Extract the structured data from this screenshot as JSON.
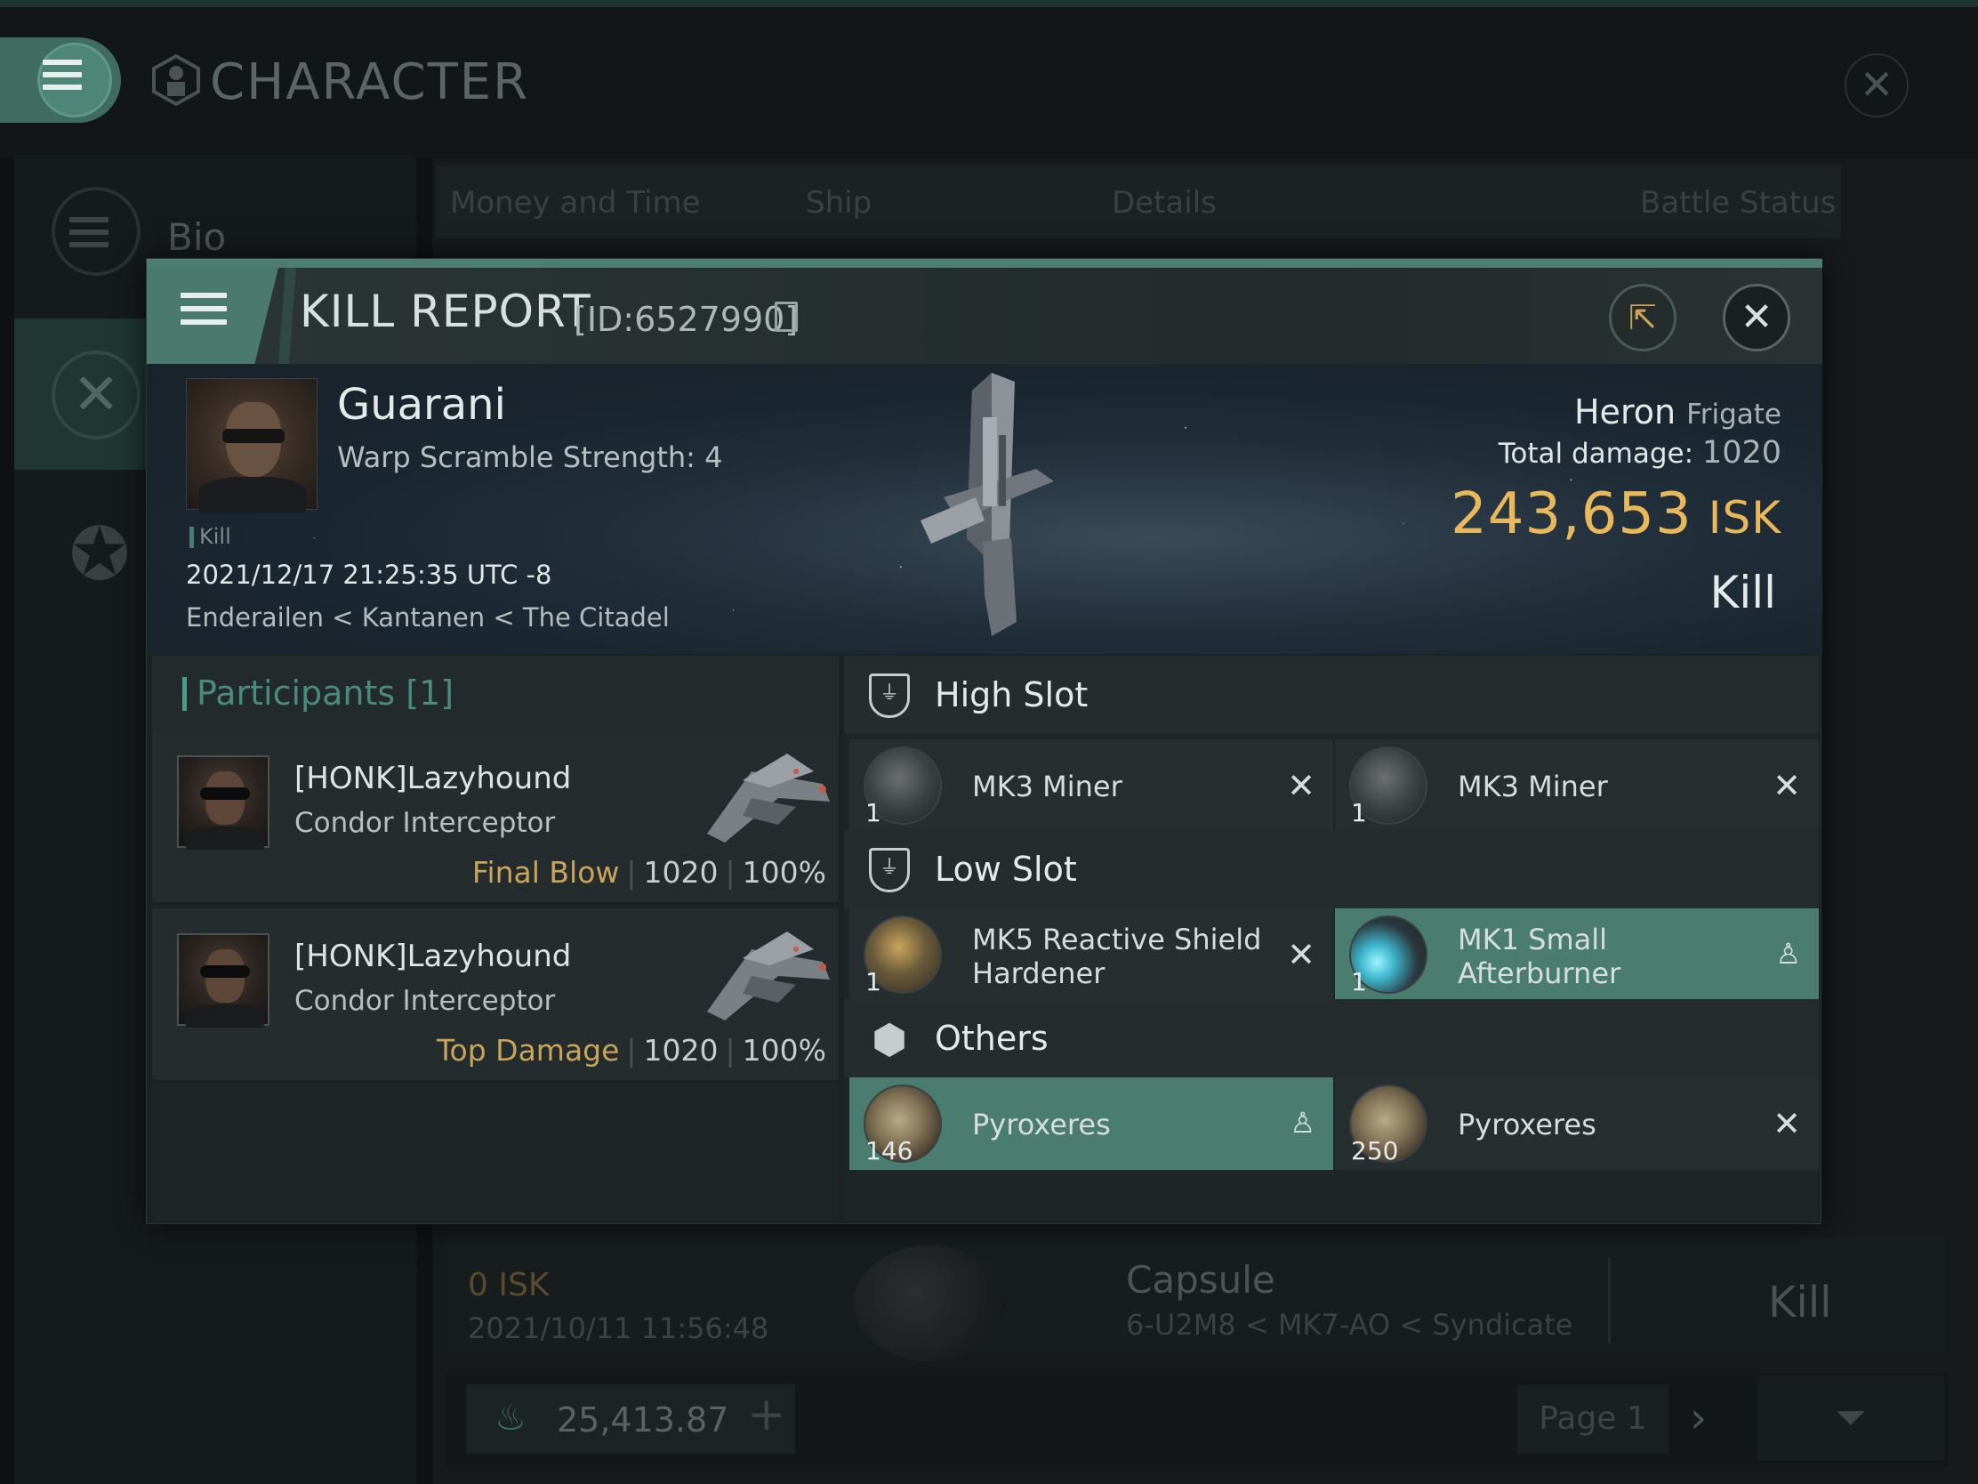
{
  "window": {
    "title": "CHARACTER",
    "close_glyph": "✕"
  },
  "sidebar": {
    "items": [
      {
        "label": "Bio",
        "icon": "hamburger-icon"
      },
      {
        "label": "",
        "icon": "crossed-swords-icon"
      },
      {
        "label": "",
        "icon": "star-icon"
      }
    ]
  },
  "tabs": [
    "Money and Time",
    "Ship",
    "Details",
    "Battle Status"
  ],
  "bg_row": {
    "isk": "0  ISK",
    "date": "2021/10/11  11:56:48",
    "ship": "Capsule",
    "location": "6-U2M8 < MK7-AO < Syndicate",
    "result": "Kill"
  },
  "bottom_bar": {
    "wallet": "25,413.87",
    "page": "Page 1"
  },
  "kill_report": {
    "title": "KILL REPORT",
    "id": "[ID:6527990]",
    "victim": {
      "name": "Guarani",
      "warp": "Warp Scramble Strength: 4",
      "tag": "Kill",
      "time": "2021/12/17 21:25:35 UTC -8",
      "location": "Enderailen < Kantanen < The Citadel",
      "ship": "Heron",
      "ship_class": "Frigate",
      "total_damage_label": "Total damage:",
      "total_damage": "1020",
      "isk_value": "243,653",
      "isk_unit": "ISK",
      "result": "Kill"
    },
    "participants": {
      "label": "Participants [1]",
      "rows": [
        {
          "name": "[HONK]Lazyhound",
          "ship": "Condor Interceptor",
          "role": "Final Blow",
          "damage": "1020",
          "percent": "100%"
        },
        {
          "name": "[HONK]Lazyhound",
          "ship": "Condor Interceptor",
          "role": "Top Damage",
          "damage": "1020",
          "percent": "100%"
        }
      ]
    },
    "slots": {
      "high": {
        "label": "High Slot",
        "items": [
          {
            "name": "MK3 Miner",
            "qty": "1",
            "status": "destroyed"
          },
          {
            "name": "MK3 Miner",
            "qty": "1",
            "status": "destroyed"
          }
        ]
      },
      "low": {
        "label": "Low Slot",
        "items": [
          {
            "name": "MK5 Reactive Shield Hardener",
            "qty": "1",
            "status": "destroyed"
          },
          {
            "name": "MK1 Small Afterburner",
            "qty": "1",
            "status": "dropped"
          }
        ]
      },
      "others": {
        "label": "Others",
        "items": [
          {
            "name": "Pyroxeres",
            "qty": "146",
            "status": "dropped"
          },
          {
            "name": "Pyroxeres",
            "qty": "250",
            "status": "destroyed"
          }
        ]
      }
    },
    "colors": {
      "accent": "#4b7c70",
      "isk": "#e8b85a",
      "role": "#c9a55c"
    }
  }
}
